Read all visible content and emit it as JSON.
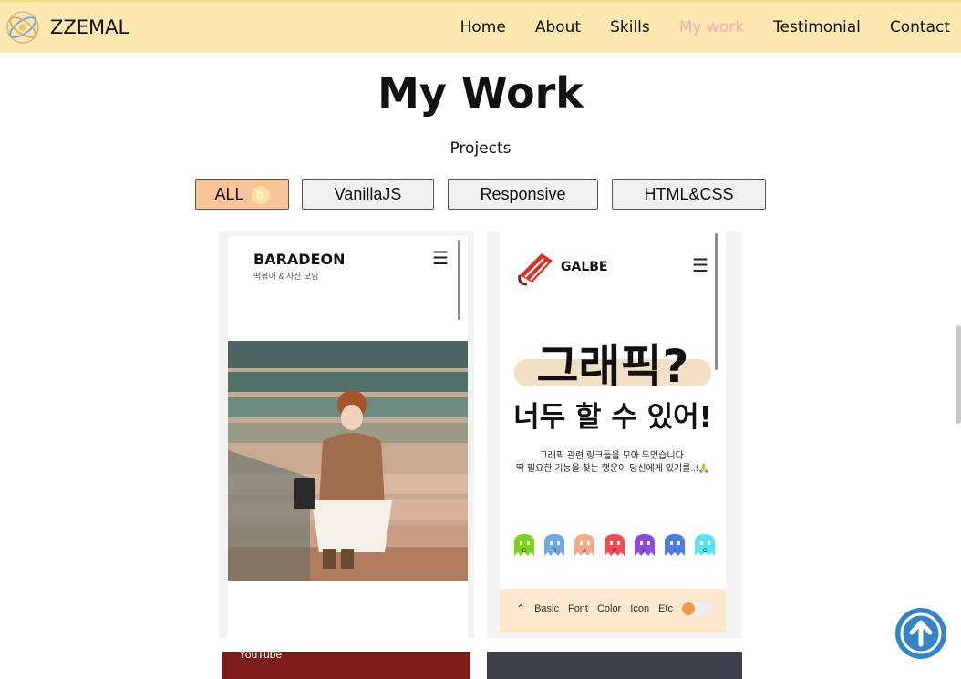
{
  "nav": {
    "brand": "ZZEMAL",
    "links": [
      "Home",
      "About",
      "Skills",
      "My work",
      "Testimonial",
      "Contact"
    ],
    "active_link": "My work",
    "active_color": "#f5a9b8",
    "bg_color": "#fde8b0"
  },
  "section": {
    "title": "My Work",
    "subtitle": "Projects"
  },
  "filters": {
    "all": {
      "label": "ALL",
      "count": "6"
    },
    "vanilla": {
      "label": "VanillaJS"
    },
    "responsive": {
      "label": "Responsive"
    },
    "htmlcss": {
      "label": "HTML&CSS"
    },
    "active": "ALL",
    "active_color": "#fbc39a"
  },
  "projects": {
    "baradeon": {
      "title": "BARADEON",
      "subtitle": "떡볶이 & 사진 모임"
    },
    "galbe": {
      "brand": "GALBE",
      "hero_line1": "그래픽?",
      "hero_line2": "너두 할 수 있어!",
      "desc_line1": "그래픽 관련 링크들을 모아 두었습니다.",
      "desc_line2": "딱 필요한 기능을 찾는 행운이 당신에게 있기를..!🙏",
      "ghost_letters": [
        "G",
        "R",
        "A",
        "P",
        "H",
        "I",
        "C"
      ],
      "ghost_colors": [
        "#7bd11f",
        "#6ea6e6",
        "#f4a88e",
        "#ee4d55",
        "#8e49e0",
        "#4b7fe6",
        "#59e3f0"
      ],
      "bottom_nav": [
        "Basic",
        "Font",
        "Color",
        "Icon",
        "Etc"
      ]
    },
    "youtube": {
      "logo_text": "YouTube"
    }
  },
  "icons": {
    "logo": "globe-logo-icon",
    "menu": "hamburger-icon",
    "scroll_top": "arrow-up-circle-icon"
  }
}
